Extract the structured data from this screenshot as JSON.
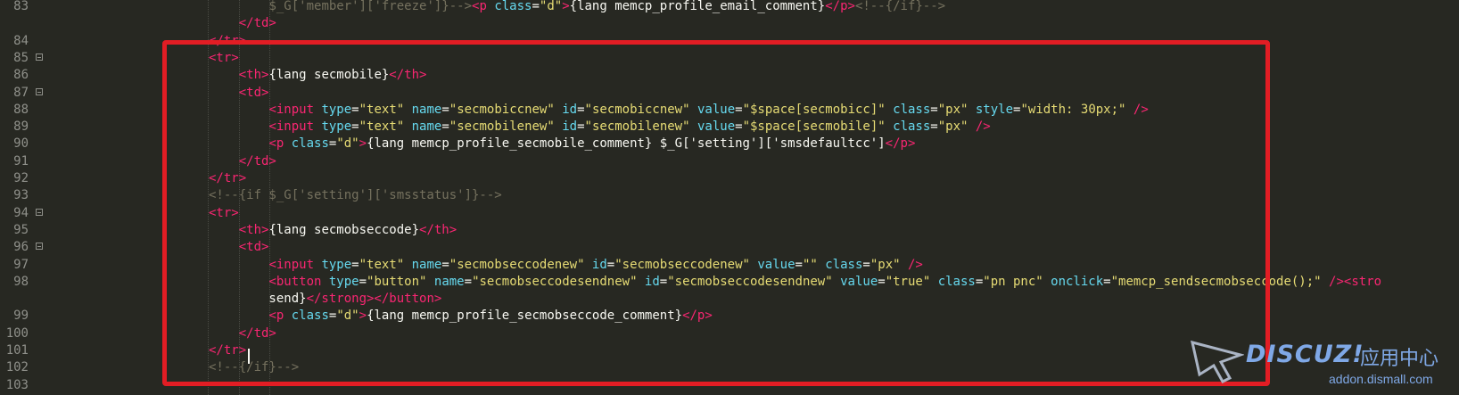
{
  "editor": {
    "lines": [
      {
        "n": "83",
        "fold": false,
        "tokens": [
          [
            "t",
            ""
          ],
          [
            "",
            "        "
          ],
          [
            "c",
            "$_G['member']['freeze']}-->"
          ],
          [
            "t",
            "<p "
          ],
          [
            "a",
            "class"
          ],
          [
            "",
            "="
          ],
          [
            "s",
            "\"d\""
          ],
          [
            "t",
            ">"
          ],
          [
            "",
            "{lang memcp_profile_email_comment}"
          ],
          [
            "t",
            "</p>"
          ],
          [
            "c",
            "<!--{/if}-->"
          ]
        ]
      },
      {
        "n": "",
        "fold": false,
        "tokens": [
          [
            "",
            "    "
          ],
          [
            "t",
            "</td>"
          ]
        ]
      },
      {
        "n": "84",
        "fold": false,
        "tokens": [
          [
            "t",
            "</tr>"
          ]
        ]
      },
      {
        "n": "85",
        "fold": true,
        "tokens": [
          [
            "t",
            "<tr>"
          ]
        ]
      },
      {
        "n": "86",
        "fold": false,
        "tokens": [
          [
            "",
            "    "
          ],
          [
            "t",
            "<th>"
          ],
          [
            "",
            "{lang secmobile}"
          ],
          [
            "t",
            "</th>"
          ]
        ]
      },
      {
        "n": "87",
        "fold": true,
        "tokens": [
          [
            "",
            "    "
          ],
          [
            "t",
            "<td>"
          ]
        ]
      },
      {
        "n": "88",
        "fold": false,
        "tokens": [
          [
            "",
            "        "
          ],
          [
            "t",
            "<input "
          ],
          [
            "a",
            "type"
          ],
          [
            "",
            "="
          ],
          [
            "s",
            "\"text\""
          ],
          [
            "",
            ""
          ],
          [
            "a",
            " name"
          ],
          [
            "",
            "="
          ],
          [
            "s",
            "\"secmobiccnew\""
          ],
          [
            "a",
            " id"
          ],
          [
            "",
            "="
          ],
          [
            "s",
            "\"secmobiccnew\""
          ],
          [
            "a",
            " value"
          ],
          [
            "",
            "="
          ],
          [
            "s",
            "\"$space[secmobicc]\""
          ],
          [
            "a",
            " class"
          ],
          [
            "",
            "="
          ],
          [
            "s",
            "\"px\""
          ],
          [
            "a",
            " style"
          ],
          [
            "",
            "="
          ],
          [
            "s",
            "\"width: 30px;\""
          ],
          [
            "t",
            " />"
          ]
        ]
      },
      {
        "n": "89",
        "fold": false,
        "tokens": [
          [
            "",
            "        "
          ],
          [
            "t",
            "<input "
          ],
          [
            "a",
            "type"
          ],
          [
            "",
            "="
          ],
          [
            "s",
            "\"text\""
          ],
          [
            "a",
            " name"
          ],
          [
            "",
            "="
          ],
          [
            "s",
            "\"secmobilenew\""
          ],
          [
            "a",
            " id"
          ],
          [
            "",
            "="
          ],
          [
            "s",
            "\"secmobilenew\""
          ],
          [
            "a",
            " value"
          ],
          [
            "",
            "="
          ],
          [
            "s",
            "\"$space[secmobile]\""
          ],
          [
            "a",
            " class"
          ],
          [
            "",
            "="
          ],
          [
            "s",
            "\"px\""
          ],
          [
            "t",
            " />"
          ]
        ]
      },
      {
        "n": "90",
        "fold": false,
        "tokens": [
          [
            "",
            "        "
          ],
          [
            "t",
            "<p "
          ],
          [
            "a",
            "class"
          ],
          [
            "",
            "="
          ],
          [
            "s",
            "\"d\""
          ],
          [
            "t",
            ">"
          ],
          [
            "",
            "{lang memcp_profile_secmobile_comment} $_G['setting']['smsdefaultcc']"
          ],
          [
            "t",
            "</p>"
          ]
        ]
      },
      {
        "n": "91",
        "fold": false,
        "tokens": [
          [
            "",
            "    "
          ],
          [
            "t",
            "</td>"
          ]
        ]
      },
      {
        "n": "92",
        "fold": false,
        "tokens": [
          [
            "t",
            "</tr>"
          ]
        ]
      },
      {
        "n": "93",
        "fold": false,
        "tokens": [
          [
            "c",
            "<!--{if $_G['setting']['smsstatus']}-->"
          ]
        ]
      },
      {
        "n": "94",
        "fold": true,
        "tokens": [
          [
            "t",
            "<tr>"
          ]
        ]
      },
      {
        "n": "95",
        "fold": false,
        "tokens": [
          [
            "",
            "    "
          ],
          [
            "t",
            "<th>"
          ],
          [
            "",
            "{lang secmobseccode}"
          ],
          [
            "t",
            "</th>"
          ]
        ]
      },
      {
        "n": "96",
        "fold": true,
        "tokens": [
          [
            "",
            "    "
          ],
          [
            "t",
            "<td>"
          ]
        ]
      },
      {
        "n": "97",
        "fold": false,
        "tokens": [
          [
            "",
            "        "
          ],
          [
            "t",
            "<input "
          ],
          [
            "a",
            "type"
          ],
          [
            "",
            "="
          ],
          [
            "s",
            "\"text\""
          ],
          [
            "a",
            " name"
          ],
          [
            "",
            "="
          ],
          [
            "s",
            "\"secmobseccodenew\""
          ],
          [
            "a",
            " id"
          ],
          [
            "",
            "="
          ],
          [
            "s",
            "\"secmobseccodenew\""
          ],
          [
            "a",
            " value"
          ],
          [
            "",
            "="
          ],
          [
            "s",
            "\"\""
          ],
          [
            "a",
            " class"
          ],
          [
            "",
            "="
          ],
          [
            "s",
            "\"px\""
          ],
          [
            "t",
            " />"
          ]
        ]
      },
      {
        "n": "98",
        "fold": false,
        "tokens": [
          [
            "",
            "        "
          ],
          [
            "t",
            "<button "
          ],
          [
            "a",
            "type"
          ],
          [
            "",
            "="
          ],
          [
            "s",
            "\"button\""
          ],
          [
            "a",
            " name"
          ],
          [
            "",
            "="
          ],
          [
            "s",
            "\"secmobseccodesendnew\""
          ],
          [
            "a",
            " id"
          ],
          [
            "",
            "="
          ],
          [
            "s",
            "\"secmobseccodesendnew\""
          ],
          [
            "a",
            " value"
          ],
          [
            "",
            "="
          ],
          [
            "s",
            "\"true\""
          ],
          [
            "a",
            " class"
          ],
          [
            "",
            "="
          ],
          [
            "s",
            "\"pn pnc\""
          ],
          [
            "a",
            " onclick"
          ],
          [
            "",
            "="
          ],
          [
            "s",
            "\"memcp_sendsecmobseccode();\""
          ],
          [
            "t",
            " /><stro"
          ]
        ]
      },
      {
        "n": "",
        "fold": false,
        "tokens": [
          [
            "",
            "        send}"
          ],
          [
            "t",
            "</strong></button>"
          ]
        ]
      },
      {
        "n": "99",
        "fold": false,
        "tokens": [
          [
            "",
            "        "
          ],
          [
            "t",
            "<p "
          ],
          [
            "a",
            "class"
          ],
          [
            "",
            "="
          ],
          [
            "s",
            "\"d\""
          ],
          [
            "t",
            ">"
          ],
          [
            "",
            "{lang memcp_profile_secmobseccode_comment}"
          ],
          [
            "t",
            "</p>"
          ]
        ]
      },
      {
        "n": "100",
        "fold": false,
        "tokens": [
          [
            "",
            "    "
          ],
          [
            "t",
            "</td>"
          ]
        ]
      },
      {
        "n": "101",
        "fold": false,
        "tokens": [
          [
            "t",
            "</tr>"
          ]
        ]
      },
      {
        "n": "102",
        "fold": false,
        "tokens": [
          [
            "c",
            "<!--{/if}-->"
          ]
        ]
      },
      {
        "n": "103",
        "fold": false,
        "tokens": []
      }
    ]
  },
  "watermark": {
    "brand": "DISCUZ!",
    "cn": "应用中心",
    "url": "addon.dismall.com"
  },
  "colors": {
    "background": "#272822",
    "tag": "#f92672",
    "attribute": "#66d9ef",
    "string": "#e6db74",
    "comment": "#75715e",
    "highlight": "#e21d24"
  }
}
